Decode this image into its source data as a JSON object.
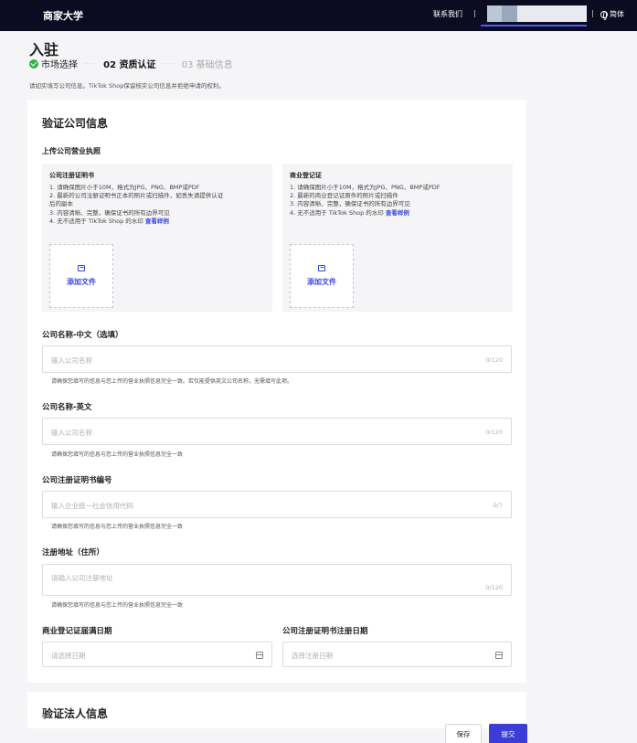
{
  "topbar": {
    "brand": "商家大学",
    "contact": "联系我们",
    "language": "简体"
  },
  "header": {
    "title": "入驻",
    "steps": [
      {
        "label": "市场选择",
        "state": "done"
      },
      {
        "label": "02 资质认证",
        "state": "current"
      },
      {
        "label": "03 基础信息",
        "state": "pending"
      }
    ],
    "notice": "请如实填写公司信息。TikTok Shop保留核实公司信息并拒绝申请的权利。"
  },
  "section": {
    "title": "验证公司信息",
    "upload_title": "上传公司营业执照",
    "cards": [
      {
        "title": "公司注册证明书",
        "lines": [
          "1. 请确保图片小于10M，格式为JPG、PNG、BMP或PDF",
          "2. 最新的公司注册证明书正本的照片或扫描件，如丢失请提供认证",
          "后的副本",
          "3. 内容清晰、完整，确保证书的所有边界可见",
          "4. 无不适用于 TikTok Shop 的水印"
        ],
        "link": "查看样例",
        "add_label": "添加文件"
      },
      {
        "title": "商业登记证",
        "lines": [
          "1. 请确保图片小于10M，格式为JPG、PNG、BMP或PDF",
          "2. 最新的商业登记证原件的照片或扫描件",
          "3. 内容清晰、完整，确保证书的所有边界可见",
          "4. 无不适用于 TikTok Shop 的水印"
        ],
        "link": "查看样例",
        "add_label": "添加文件"
      }
    ],
    "fields": {
      "name_cn": {
        "label": "公司名称-中文（选填）",
        "placeholder": "输入公司名称",
        "counter": "0/120",
        "hint": "请确保您填写的信息与您上传的营业执照信息完全一致。若仅能提供英文公司名称，无需填写此项。"
      },
      "name_en": {
        "label": "公司名称-英文",
        "placeholder": "输入公司名称",
        "counter": "0/120",
        "hint": "请确保您填写的信息与您上传的营业执照信息完全一致"
      },
      "reg_no": {
        "label": "公司注册证明书编号",
        "placeholder": "输入企业统一社会信用代码",
        "counter": "0/7",
        "hint": "请确保您填写的信息与您上传的营业执照信息完全一致"
      },
      "address": {
        "label": "注册地址（住所）",
        "placeholder": "请输入公司注册地址",
        "counter": "0/120",
        "hint": "请确保您填写的信息与您上传的营业执照信息完全一致"
      },
      "expiry": {
        "label": "商业登记证届满日期",
        "placeholder": "请选择日期"
      },
      "reg_date": {
        "label": "公司注册证明书注册日期",
        "placeholder": "选择注册日期"
      }
    }
  },
  "section2": {
    "title": "验证法人信息"
  },
  "footer": {
    "save": "保存",
    "submit": "提交"
  }
}
